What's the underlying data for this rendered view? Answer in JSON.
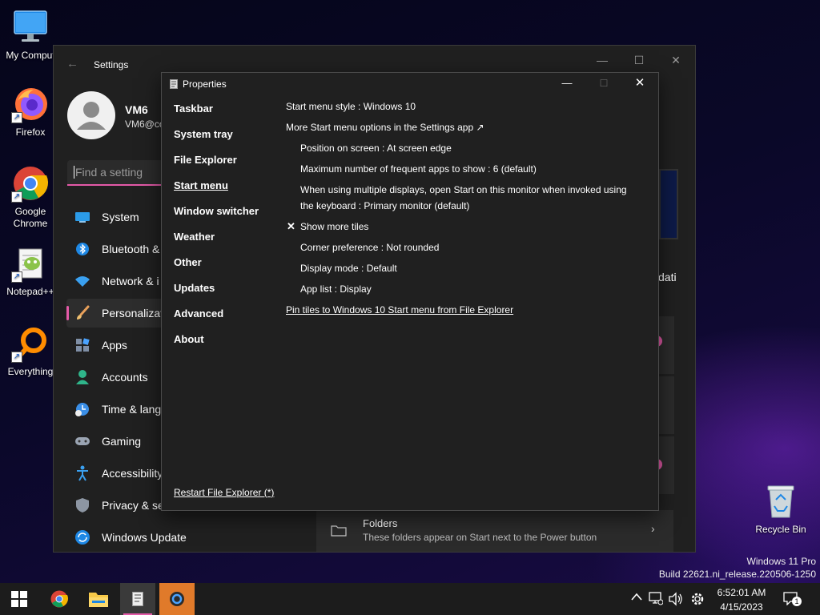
{
  "desktop": {
    "icons": [
      {
        "label": "My Comput"
      },
      {
        "label": "Firefox"
      },
      {
        "label": "Google Chrome"
      },
      {
        "label": "Notepad++"
      },
      {
        "label": "Everything"
      },
      {
        "label": "Recycle Bin"
      }
    ],
    "watermark": {
      "line1": "Windows 11 Pro",
      "line2": "Build 22621.ni_release.220506-1250"
    }
  },
  "settings": {
    "title": "Settings",
    "user": {
      "name": "VM6",
      "email": "VM6@co"
    },
    "search_placeholder": "Find a setting",
    "nav": [
      {
        "label": "System",
        "icon": "system-icon"
      },
      {
        "label": "Bluetooth &",
        "icon": "bluetooth-icon"
      },
      {
        "label": "Network & i",
        "icon": "network-icon"
      },
      {
        "label": "Personalizat",
        "icon": "brush-icon"
      },
      {
        "label": "Apps",
        "icon": "apps-icon"
      },
      {
        "label": "Accounts",
        "icon": "accounts-icon"
      },
      {
        "label": "Time & lang",
        "icon": "time-icon"
      },
      {
        "label": "Gaming",
        "icon": "gaming-icon"
      },
      {
        "label": "Accessibility",
        "icon": "accessibility-icon"
      },
      {
        "label": "Privacy & se",
        "icon": "shield-icon"
      },
      {
        "label": "Windows Update",
        "icon": "update-icon"
      }
    ],
    "partial_text": "dati",
    "folders": {
      "title": "Folders",
      "subtitle": "These folders appear on Start next to the Power button"
    }
  },
  "properties": {
    "title": "Properties",
    "sidebar": [
      "Taskbar",
      "System tray",
      "File Explorer",
      "Start menu",
      "Window switcher",
      "Weather",
      "Other",
      "Updates",
      "Advanced",
      "About"
    ],
    "active": "Start menu",
    "restart_link": "Restart File Explorer (*)",
    "options": {
      "style": "Start menu style : Windows 10",
      "more": "More Start menu options in the Settings app ↗",
      "position": "Position on screen : At screen edge",
      "max_frequent": "Maximum number of frequent apps to show : 6 (default)",
      "multi_display": "When using multiple displays, open Start on this monitor when invoked using the keyboard : Primary monitor (default)",
      "show_more_tiles": "Show more tiles",
      "corner": "Corner preference : Not rounded",
      "display_mode": "Display mode : Default",
      "app_list": "App list : Display",
      "pin_tiles": "Pin tiles to Windows 10 Start menu from File Explorer"
    }
  },
  "taskbar": {
    "time": "6:52:01 AM",
    "date": "4/15/2023",
    "notification_count": "1"
  },
  "colors": {
    "accent": "#e45aa8",
    "window_bg": "#202020",
    "taskbar_bg": "#1c1c1c"
  }
}
